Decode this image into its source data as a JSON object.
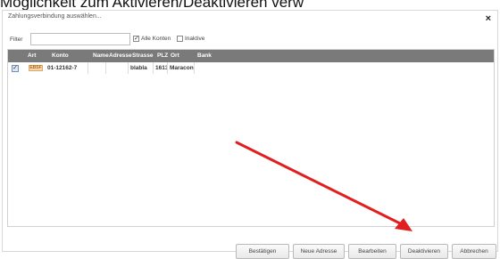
{
  "page": {
    "top_text": "Möglichkeit zum Aktivieren/Deaktivieren verw"
  },
  "dialog": {
    "title": "Zahlungsverbindung auswählen...",
    "close_glyph": "×"
  },
  "filter": {
    "label": "Filter",
    "value": "",
    "alle_konten_label": "Alle Konten",
    "alle_konten_checked": true,
    "inaktive_label": "Inaktive",
    "inaktive_checked": false
  },
  "table": {
    "columns": [
      "Art",
      "Konto",
      "Name",
      "Adresse",
      "Strasse",
      "PLZ",
      "Ort",
      "Bank"
    ],
    "rows": [
      {
        "selected": true,
        "art": "EBSF",
        "konto": "01-12162-7",
        "name": "",
        "adresse": "",
        "strasse": "blabla",
        "plz": "1613",
        "ort": "Maracon",
        "bank": ""
      }
    ]
  },
  "buttons": {
    "bestaetigen": "Bestätigen",
    "neue_adresse": "Neue Adresse",
    "bearbeiten": "Bearbeiten",
    "deaktivieren": "Deaktivieren",
    "abbrechen": "Abbrechen"
  },
  "annotation": {
    "arrow_color": "#e02020"
  }
}
